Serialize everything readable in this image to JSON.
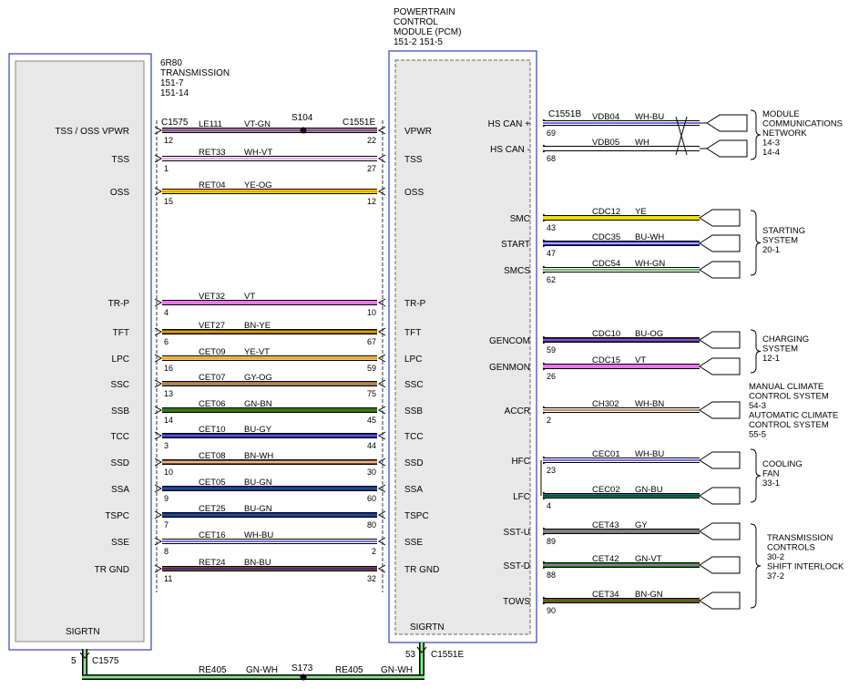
{
  "left_module": {
    "title": [
      "6R80",
      "TRANSMISSION",
      "151-7",
      "151-14"
    ],
    "ground_pin": "SIGRTN"
  },
  "pcm": {
    "title": [
      "POWERTRAIN",
      "CONTROL",
      "MODULE (PCM)",
      "151-2   151-5"
    ],
    "ground_pin": "SIGRTN"
  },
  "connectors": {
    "trans_connector": "C1575",
    "pcm_connector_left": "C1551E",
    "pcm_connector_right": "C1551B"
  },
  "splices": {
    "top_splice": "S104",
    "ground_splice": "S173"
  },
  "left_wires": [
    {
      "left_label": "TSS / OSS VPWR",
      "left_pin": "12",
      "circuit": "LE111",
      "color_name": "VT-GN",
      "right_pin": "22",
      "pcm_label": "VPWR",
      "colors": [
        "#e070e0",
        "#008000"
      ]
    },
    {
      "left_label": "TSS",
      "left_pin": "1",
      "circuit": "RET33",
      "color_name": "WH-VT",
      "right_pin": "27",
      "pcm_label": "TSS",
      "colors": [
        "#ffffff",
        "#e070e0"
      ]
    },
    {
      "left_label": "OSS",
      "left_pin": "15",
      "circuit": "RET04",
      "color_name": "YE-OG",
      "right_pin": "12",
      "pcm_label": "OSS",
      "colors": [
        "#f0e000",
        "#f08000"
      ]
    },
    {
      "left_label": "TR-P",
      "left_pin": "4",
      "circuit": "VET32",
      "color_name": "VT",
      "right_pin": "10",
      "pcm_label": "TR-P",
      "colors": [
        "#e878e8",
        "#e878e8"
      ]
    },
    {
      "left_label": "TFT",
      "left_pin": "6",
      "circuit": "VET27",
      "color_name": "BN-YE",
      "right_pin": "67",
      "pcm_label": "TFT",
      "colors": [
        "#8a4a1a",
        "#f0e000"
      ]
    },
    {
      "left_label": "LPC",
      "left_pin": "16",
      "circuit": "CET09",
      "color_name": "YE-VT",
      "right_pin": "59",
      "pcm_label": "LPC",
      "colors": [
        "#f0e000",
        "#e070e0"
      ]
    },
    {
      "left_label": "SSC",
      "left_pin": "13",
      "circuit": "CET07",
      "color_name": "GY-OG",
      "right_pin": "75",
      "pcm_label": "SSC",
      "colors": [
        "#808080",
        "#f08000"
      ]
    },
    {
      "left_label": "SSB",
      "left_pin": "14",
      "circuit": "CET06",
      "color_name": "GN-BN",
      "right_pin": "45",
      "pcm_label": "SSB",
      "colors": [
        "#118811",
        "#8a4a1a"
      ]
    },
    {
      "left_label": "TCC",
      "left_pin": "3",
      "circuit": "CET10",
      "color_name": "BU-GY",
      "right_pin": "44",
      "pcm_label": "TCC",
      "colors": [
        "#1a1acc",
        "#808080"
      ]
    },
    {
      "left_label": "SSD",
      "left_pin": "10",
      "circuit": "CET08",
      "color_name": "BN-WH",
      "right_pin": "30",
      "pcm_label": "SSD",
      "colors": [
        "#8a4a1a",
        "#ffffff"
      ]
    },
    {
      "left_label": "SSA",
      "left_pin": "9",
      "circuit": "CET05",
      "color_name": "BU-GN",
      "right_pin": "60",
      "pcm_label": "SSA",
      "colors": [
        "#1a1acc",
        "#118811"
      ]
    },
    {
      "left_label": "TSPC",
      "left_pin": "7",
      "circuit": "CET25",
      "color_name": "BU-GN",
      "right_pin": "80",
      "pcm_label": "TSPC",
      "colors": [
        "#1a1acc",
        "#118811"
      ]
    },
    {
      "left_label": "SSE",
      "left_pin": "8",
      "circuit": "CET16",
      "color_name": "WH-BU",
      "right_pin": "2",
      "pcm_label": "SSE",
      "colors": [
        "#ffffff",
        "#1a1acc"
      ]
    },
    {
      "left_label": "TR GND",
      "left_pin": "11",
      "circuit": "RET24",
      "color_name": "BN-BU",
      "right_pin": "32",
      "pcm_label": "TR GND",
      "colors": [
        "#8a4a1a",
        "#1a1acc"
      ]
    }
  ],
  "right_wires": [
    {
      "pcm_label": "HS CAN +",
      "pin": "69",
      "circuit": "VDB04",
      "color_name": "WH-BU",
      "colors": [
        "#ffffff",
        "#1a1acc"
      ]
    },
    {
      "pcm_label": "HS CAN -",
      "pin": "68",
      "circuit": "VDB05",
      "color_name": "WH",
      "colors": [
        "#ffffff",
        "#ffffff"
      ]
    },
    {
      "pcm_label": "SMC",
      "pin": "43",
      "circuit": "CDC12",
      "color_name": "YE",
      "colors": [
        "#f0e000",
        "#f0e000"
      ]
    },
    {
      "pcm_label": "START",
      "pin": "47",
      "circuit": "CDC35",
      "color_name": "BU-WH",
      "colors": [
        "#1a1acc",
        "#ffffff"
      ]
    },
    {
      "pcm_label": "SMCS",
      "pin": "62",
      "circuit": "CDC54",
      "color_name": "WH-GN",
      "colors": [
        "#ffffff",
        "#118811"
      ]
    },
    {
      "pcm_label": "GENCOM",
      "pin": "59",
      "circuit": "CDC10",
      "color_name": "BU-OG",
      "colors": [
        "#1a1acc",
        "#f08000"
      ]
    },
    {
      "pcm_label": "GENMON",
      "pin": "26",
      "circuit": "CDC15",
      "color_name": "VT",
      "colors": [
        "#e878e8",
        "#e878e8"
      ]
    },
    {
      "pcm_label": "ACCR",
      "pin": "2",
      "circuit": "CH302",
      "color_name": "WH-BN",
      "colors": [
        "#ffffff",
        "#8a4a1a"
      ]
    },
    {
      "pcm_label": "HFC",
      "pin": "23",
      "circuit": "CEC01",
      "color_name": "WH-BU",
      "colors": [
        "#ffffff",
        "#1a1acc"
      ]
    },
    {
      "pcm_label": "LFC",
      "pin": "4",
      "circuit": "CEC02",
      "color_name": "GN-BU",
      "colors": [
        "#118811",
        "#1a1acc"
      ]
    },
    {
      "pcm_label": "SST-U",
      "pin": "89",
      "circuit": "CET43",
      "color_name": "GY",
      "colors": [
        "#808080",
        "#808080"
      ]
    },
    {
      "pcm_label": "SST-D",
      "pin": "88",
      "circuit": "CET42",
      "color_name": "GN-VT",
      "colors": [
        "#118811",
        "#e070e0"
      ]
    },
    {
      "pcm_label": "TOWS",
      "pin": "90",
      "circuit": "CET34",
      "color_name": "BN-GN",
      "colors": [
        "#8a4a1a",
        "#118811"
      ]
    }
  ],
  "destinations": [
    {
      "lines": [
        "MODULE",
        "COMMUNICATIONS",
        "NETWORK",
        "14-3",
        "14-4"
      ]
    },
    {
      "lines": [
        "STARTING",
        "SYSTEM",
        "20-1"
      ]
    },
    {
      "lines": [
        "CHARGING",
        "SYSTEM",
        "12-1"
      ]
    },
    {
      "lines": [
        "MANUAL CLIMATE",
        "CONTROL SYSTEM",
        "54-3",
        "AUTOMATIC CLIMATE",
        "CONTROL SYSTEM",
        "55-5"
      ]
    },
    {
      "lines": [
        "COOLING",
        "FAN",
        "33-1"
      ]
    },
    {
      "lines": [
        "TRANSMISSION",
        "CONTROLS",
        "30-2",
        "SHIFT INTERLOCK",
        "37-2"
      ]
    }
  ],
  "ground_wire": {
    "left_pin": "5",
    "left_connector": "C1575",
    "right_pin": "53",
    "right_connector": "C1551E",
    "segments": [
      {
        "circuit": "RE405",
        "color_name": "GN-WH"
      },
      {
        "circuit": "RE405",
        "color_name": "GN-WH"
      }
    ],
    "colors": [
      "#118811",
      "#ffffff"
    ]
  }
}
